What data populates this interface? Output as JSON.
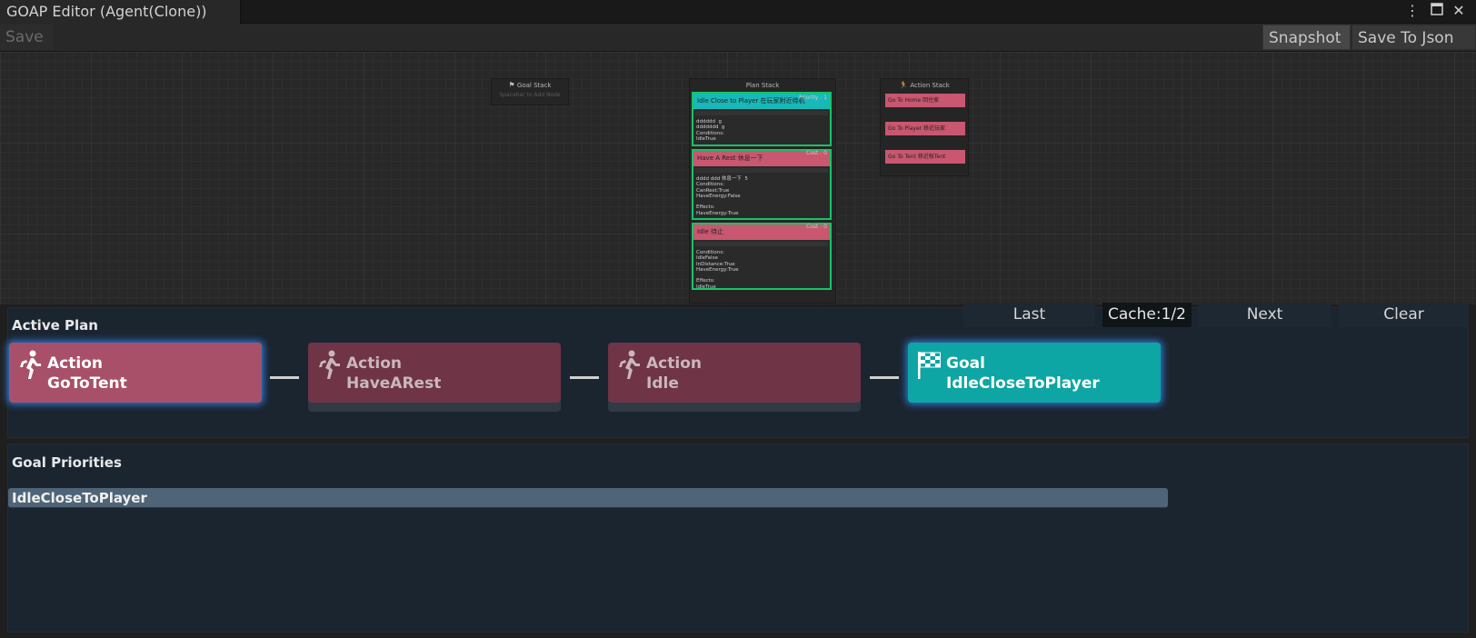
{
  "window": {
    "tab_title": "GOAP Editor (Agent(Clone))"
  },
  "toolbar": {
    "save_label": "Save",
    "snapshot_label": "Snapshot",
    "save_json_label": "Save To Json"
  },
  "graph": {
    "goal_stack": {
      "title": "Goal Stack",
      "hint": "Spacebar to Add Node"
    },
    "plan_stack": {
      "title": "Plan Stack",
      "nodes": [
        {
          "header": "Idle Close to Player 在玩家附近待机",
          "badge": "Priority : 1",
          "body": "dddddd  g\nddddddd  g\nConditions:\nIdleTrue"
        },
        {
          "header": "Have A Rest 休息一下",
          "badge": "Cost : 0",
          "body": "dddd ddd 休息一下  5\nConditions:\nCanRest:True\nHaveEnergy:False\n\nEffects:\nHaveEnergy:True"
        },
        {
          "header": "Idle 待止",
          "badge": "Cost : 0",
          "body": "Conditions:\nIdleFalse\nInDistance:True\nHaveEnergy:True\n\nEffects:\nIdleTrue"
        }
      ]
    },
    "action_stack": {
      "title": "Action Stack",
      "items": [
        "Go To Home 回住家",
        "Go To Player 移近玩家",
        "Go To Tent 移近帐Tent"
      ]
    }
  },
  "active_plan": {
    "label": "Active Plan",
    "cache": {
      "last": "Last",
      "counter": "Cache:1/2",
      "next": "Next",
      "clear": "Clear"
    },
    "cards": [
      {
        "kind": "Action",
        "name": "GoToTent",
        "icon": "running-person-icon"
      },
      {
        "kind": "Action",
        "name": "HaveARest",
        "icon": "running-person-icon"
      },
      {
        "kind": "Action",
        "name": "Idle",
        "icon": "running-person-icon"
      },
      {
        "kind": "Goal",
        "name": "IdleCloseToPlayer",
        "icon": "checkered-flag-icon"
      }
    ]
  },
  "goal_priorities": {
    "label": "Goal Priorities",
    "items": [
      "IdleCloseToPlayer"
    ]
  },
  "colors": {
    "action": "#a8506a",
    "goal": "#0ea5a5",
    "highlight": "#2f7bd9",
    "node_border": "#16c466"
  }
}
